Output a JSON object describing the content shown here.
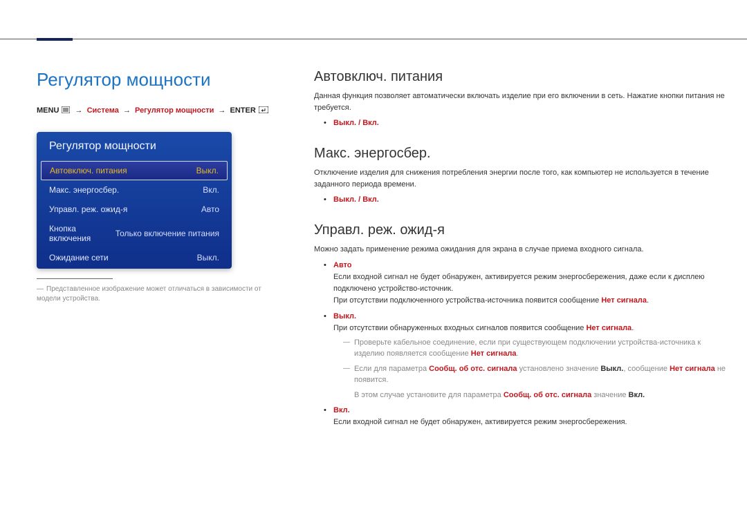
{
  "page_title": "Регулятор мощности",
  "breadcrumb": {
    "menu": "MENU",
    "system": "Система",
    "power_control": "Регулятор мощности",
    "enter": "ENTER"
  },
  "menu_widget": {
    "title": "Регулятор мощности",
    "items": [
      {
        "label": "Автовключ. питания",
        "value": "Выкл.",
        "selected": true
      },
      {
        "label": "Макс. энергосбер.",
        "value": "Вкл.",
        "selected": false
      },
      {
        "label": "Управл. реж. ожид-я",
        "value": "Авто",
        "selected": false
      },
      {
        "label": "Кнопка включения",
        "value": "Только включение питания",
        "selected": false
      },
      {
        "label": "Ожидание сети",
        "value": "Выкл.",
        "selected": false
      }
    ]
  },
  "disclaimer": "Представленное изображение может отличаться в зависимости от модели устройства.",
  "sections": {
    "auto_power": {
      "heading": "Автовключ. питания",
      "body": "Данная функция позволяет автоматически включать изделие при его включении в сеть. Нажатие кнопки питания не требуется.",
      "option": "Выкл. / Вкл."
    },
    "max_energy": {
      "heading": "Макс. энергосбер.",
      "body": "Отключение изделия для снижения потребления энергии после того, как компьютер не используется в течение заданного периода времени.",
      "option": "Выкл. / Вкл."
    },
    "standby": {
      "heading": "Управл. реж. ожид-я",
      "body": "Можно задать применение режима ожидания для экрана в случае приема входного сигнала.",
      "auto": {
        "label": "Авто",
        "line1": "Если входной сигнал не будет обнаружен, активируется режим энергосбережения, даже если к дисплею подключено устройство-источник.",
        "line2_pre": "При отсутствии подключенного устройства-источника появится сообщение ",
        "line2_hi": "Нет сигнала",
        "line2_post": "."
      },
      "off": {
        "label": "Выкл.",
        "line1_pre": "При отсутствии обнаруженных входных сигналов появится сообщение ",
        "line1_hi": "Нет сигнала",
        "line1_post": ".",
        "sub1_pre": "Проверьте кабельное соединение, если при существующем подключении устройства-источника к изделию появляется сообщение ",
        "sub1_hi": "Нет сигнала",
        "sub1_post": ".",
        "sub2_pre": "Если для параметра ",
        "sub2_hi1": "Сообщ. об отс. сигнала",
        "sub2_mid": " установлено значение ",
        "sub2_hi2": "Выкл.",
        "sub2_mid2": ", сообщение ",
        "sub2_hi3": "Нет сигнала",
        "sub2_post": " не появится.",
        "sub2b_pre": "В этом случае установите для параметра ",
        "sub2b_hi1": "Сообщ. об отс. сигнала",
        "sub2b_mid": " значение ",
        "sub2b_hi2": "Вкл.",
        "sub2b_post": ""
      },
      "on": {
        "label": "Вкл.",
        "line1": "Если входной сигнал не будет обнаружен, активируется режим энергосбережения."
      }
    }
  }
}
